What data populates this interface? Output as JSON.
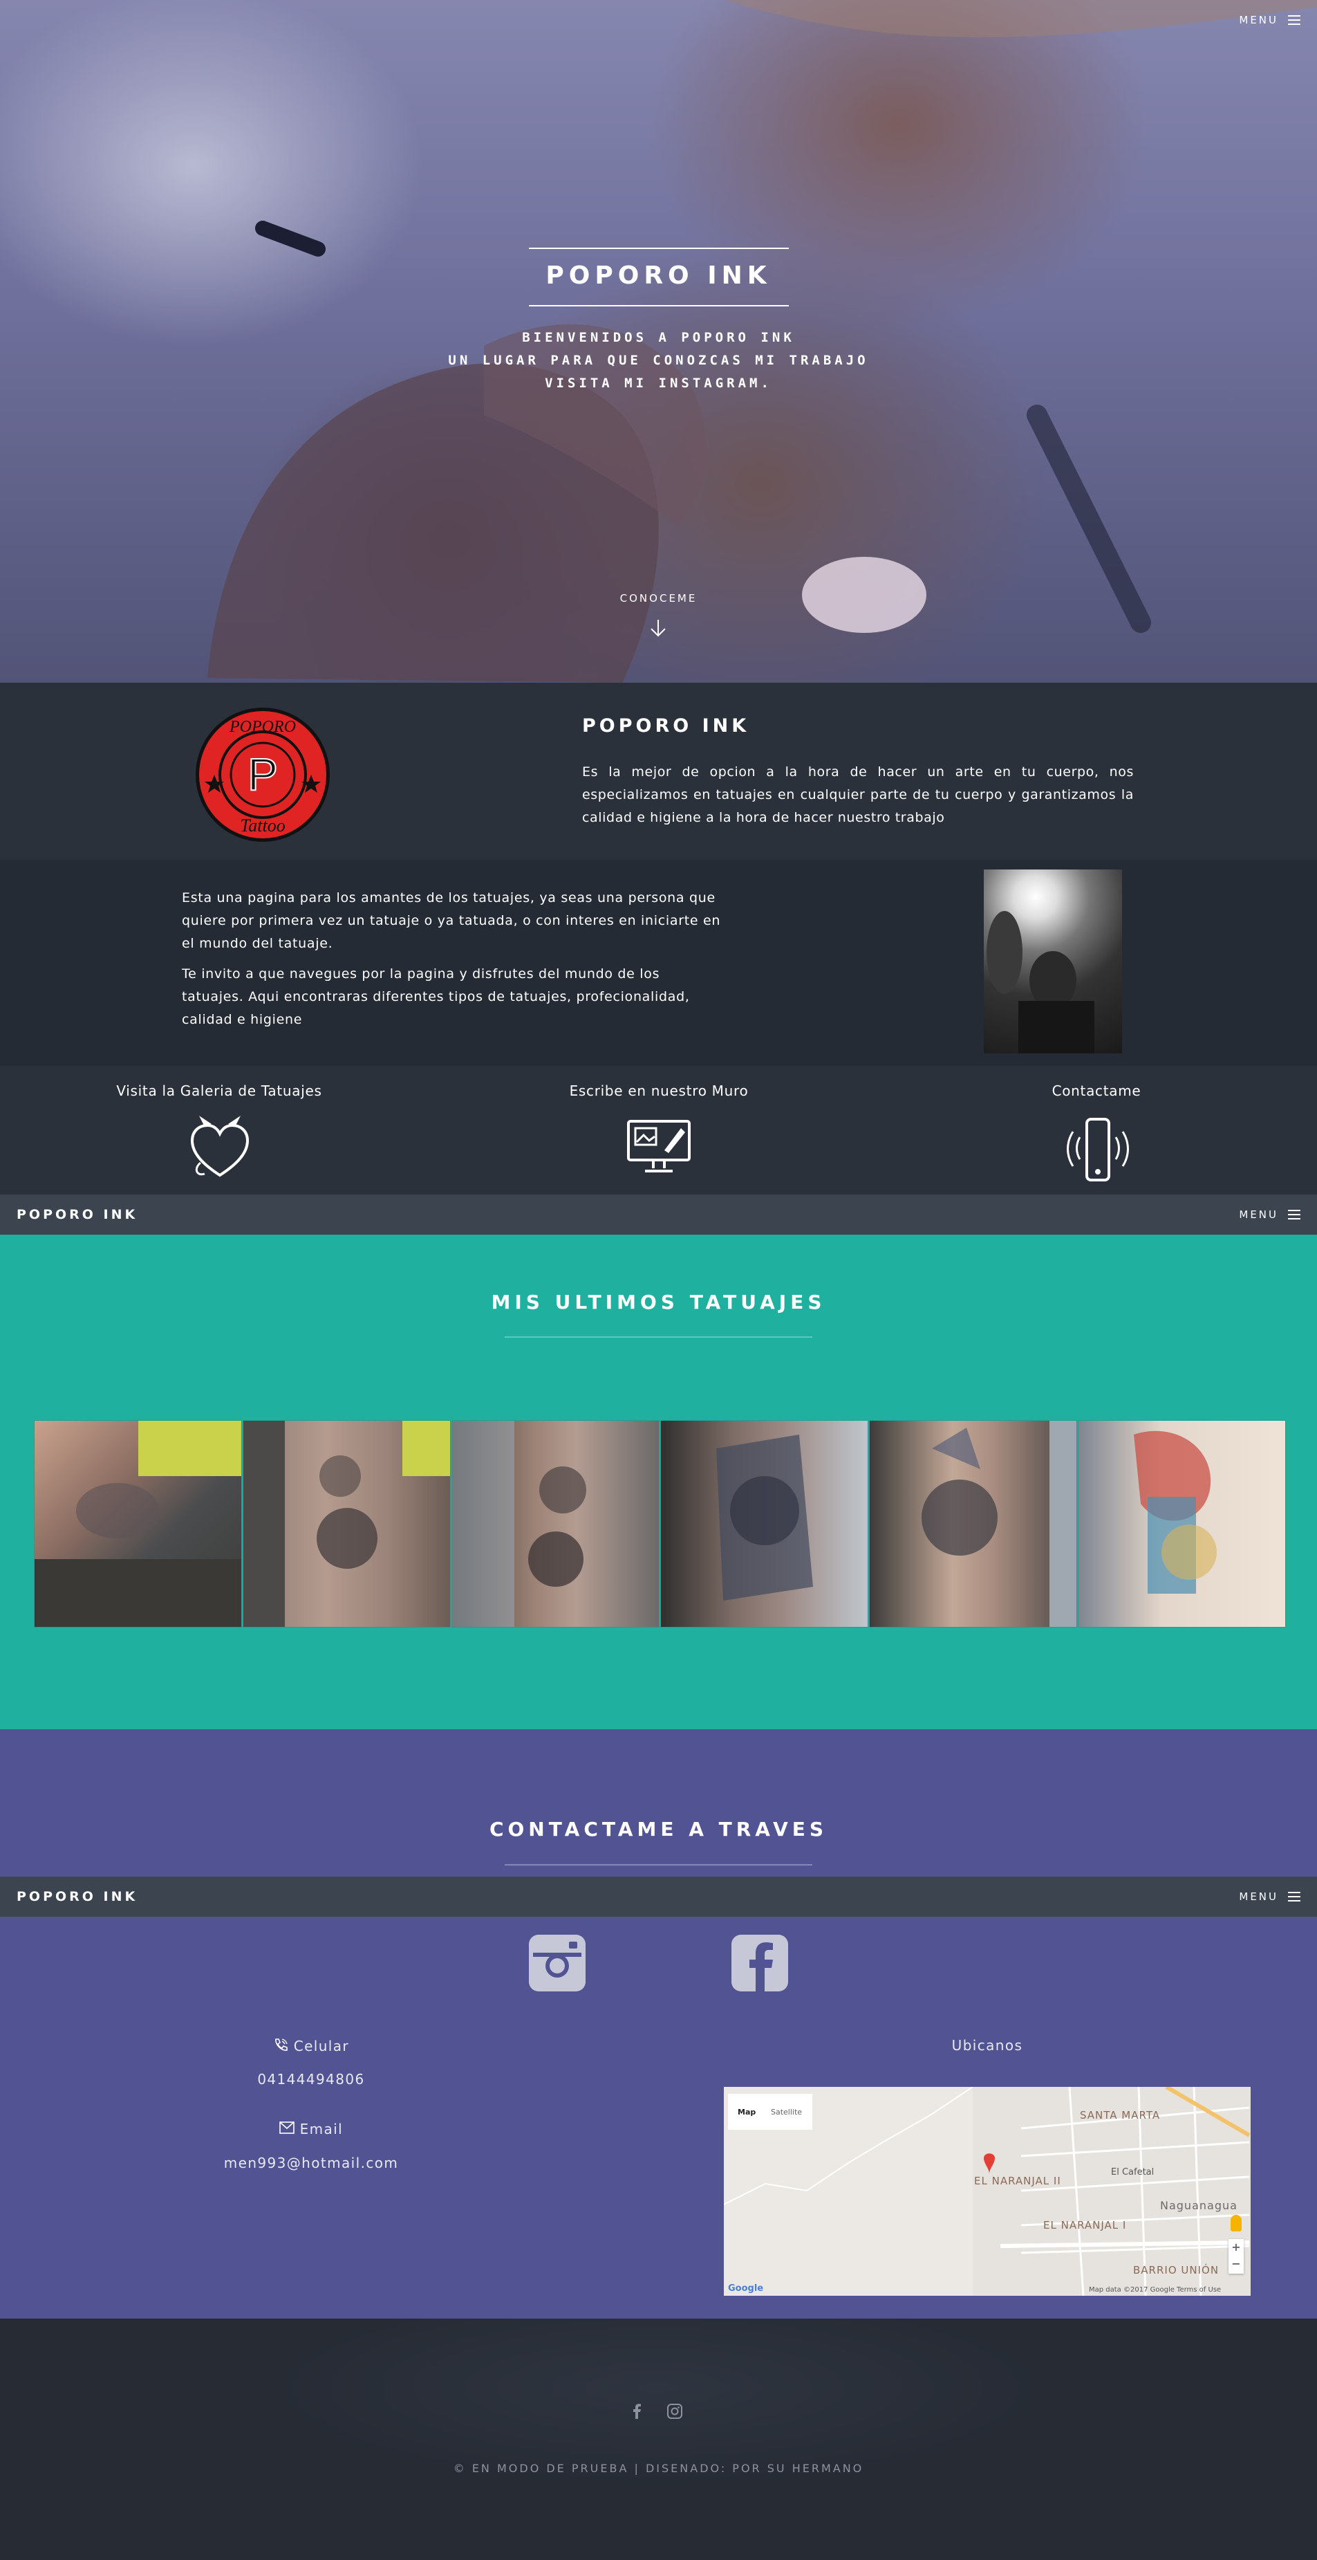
{
  "hero": {
    "title": "POPORO INK",
    "subtitle_lines": [
      "BIENVENIDOS A POPORO INK",
      "UN LUGAR PARA QUE CONOZCAS MI TRABAJO",
      "VISITA MI INSTAGRAM."
    ],
    "cta": "CONOCEME",
    "menu_label": "MENU"
  },
  "about": {
    "title": "POPORO INK",
    "text": "Es la mejor de opcion a la hora de hacer un arte en tu cuerpo, nos especializamos en tatuajes en cualquier parte de tu cuerpo y garantizamos la calidad e higiene a la hora de hacer nuestro trabajo",
    "logo_text_top": "POPORO",
    "logo_letter": "P",
    "logo_text_bottom": "Tattoo"
  },
  "intro": {
    "p1": "Esta una pagina para los amantes de los tatuajes, ya seas una persona que quiere por primera vez un tatuaje o ya tatuada, o con interes en iniciarte en el mundo del tatuaje.",
    "p2": "Te invito a que navegues por la pagina y disfrutes del mundo de los tatuajes. Aqui encontraras diferentes tipos de tatuajes, profecionalidad, calidad e higiene"
  },
  "links": [
    {
      "label": "Visita la Galeria de Tatuajes",
      "icon": "heart-devil-icon"
    },
    {
      "label": "Escribe en nuestro Muro",
      "icon": "monitor-pen-icon"
    },
    {
      "label": "Contactame",
      "icon": "phone-icon"
    }
  ],
  "navbar": {
    "brand": "POPORO INK",
    "menu_label": "MENU"
  },
  "gallery": {
    "title": "MIS ULTIMOS TATUAJES",
    "tiles": [
      "tattoo-photo-1",
      "tattoo-photo-2",
      "tattoo-photo-3",
      "tattoo-photo-4",
      "tattoo-photo-5",
      "tattoo-photo-6"
    ]
  },
  "contact": {
    "title": "CONTACTAME A TRAVES",
    "phone_label": "Celular",
    "phone": "04144494806",
    "email_label": "Email",
    "email": "men993@hotmail.com",
    "map_label": "Ubicanos",
    "map": {
      "tab_map": "Map",
      "tab_satellite": "Satellite",
      "places": [
        "SANTA MARTA",
        "EL NARANJAL II",
        "El Cafetal",
        "Naguanagua",
        "EL NARANJAL I",
        "BARRIO UNIÓN"
      ],
      "footer": "Map data ©2017 Google   Terms of Use",
      "google": "Google"
    }
  },
  "footer": {
    "copyright": "© EN MODO DE PRUEBA  |  DISENADO: POR SU HERMANO"
  },
  "colors": {
    "teal": "#1fb09f",
    "purple": "#515393",
    "dark": "#2b313b"
  }
}
